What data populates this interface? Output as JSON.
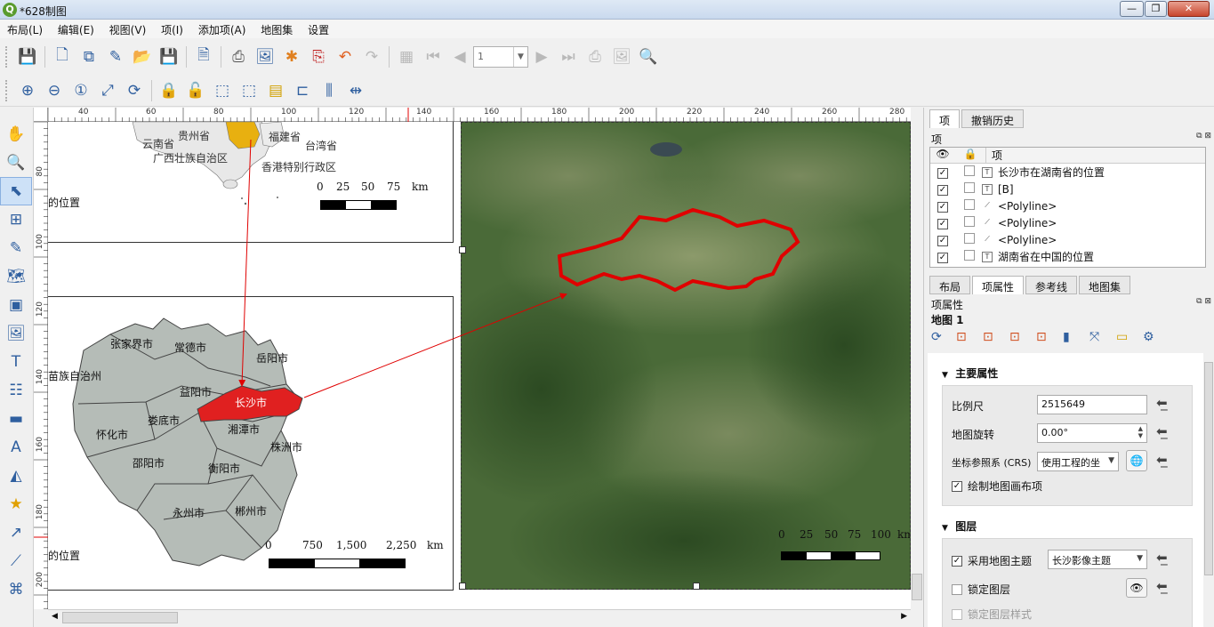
{
  "window": {
    "title": "*628制图",
    "logo": "Q",
    "min": "—",
    "max": "❐",
    "close": "✕"
  },
  "menu": [
    "布局(L)",
    "编辑(E)",
    "视图(V)",
    "项(I)",
    "添加项(A)",
    "地图集",
    "设置"
  ],
  "toolbar": {
    "page_number": "1"
  },
  "ruler_top_ticks": [
    "40",
    "60",
    "80",
    "100",
    "120",
    "140",
    "160",
    "180",
    "200",
    "220",
    "240",
    "260",
    "280"
  ],
  "ruler_left_ticks": [
    "80",
    "100",
    "120",
    "140",
    "160",
    "180",
    "200"
  ],
  "map_overview": {
    "provinces": [
      "云南省",
      "贵州省",
      "福建省",
      "台湾省",
      "广西壮族自治区",
      "香港特别行政区"
    ],
    "scale": [
      "0",
      "25",
      "50",
      "75",
      "km"
    ],
    "caption": "的位置"
  },
  "map_hunan": {
    "cities": [
      "张家界市",
      "常德市",
      "岳阳市",
      "益阳市",
      "长沙市",
      "湘潭市",
      "株洲市",
      "娄底市",
      "怀化市",
      "邵阳市",
      "衡阳市",
      "永州市",
      "郴州市",
      "苗族自治州"
    ],
    "scale": [
      "0",
      "750",
      "1,500",
      "2,250",
      "km"
    ],
    "caption": "的位置"
  },
  "map_satellite": {
    "scale": [
      "0",
      "25",
      "50",
      "75",
      "100",
      "km"
    ]
  },
  "right_panel": {
    "top_tabs": [
      "项",
      "撤销历史"
    ],
    "items_title": "项",
    "items_header": "项",
    "items": [
      {
        "type": "T",
        "name": "长沙市在湖南省的位置"
      },
      {
        "type": "T",
        "name": "[B]"
      },
      {
        "type": "⟋",
        "name": "<Polyline>"
      },
      {
        "type": "⟋",
        "name": "<Polyline>"
      },
      {
        "type": "⟋",
        "name": "<Polyline>"
      },
      {
        "type": "T",
        "name": "湖南省在中国的位置"
      }
    ],
    "bottom_tabs": [
      "布局",
      "项属性",
      "参考线",
      "地图集"
    ],
    "props_title": "项属性",
    "item_name": "地图 1",
    "main_section": "主要属性",
    "scale_label": "比例尺",
    "scale_value": "2515649",
    "rotation_label": "地图旋转",
    "rotation_value": "0.00°",
    "crs_label": "坐标参照系 (CRS)",
    "crs_value": "使用工程的坐",
    "draw_items_label": "绘制地图画布项",
    "layers_section": "图层",
    "follow_theme_label": "采用地图主题",
    "theme_value": "长沙影像主题",
    "lock_layers_label": "锁定图层",
    "lock_styles_label": "锁定图层样式"
  }
}
